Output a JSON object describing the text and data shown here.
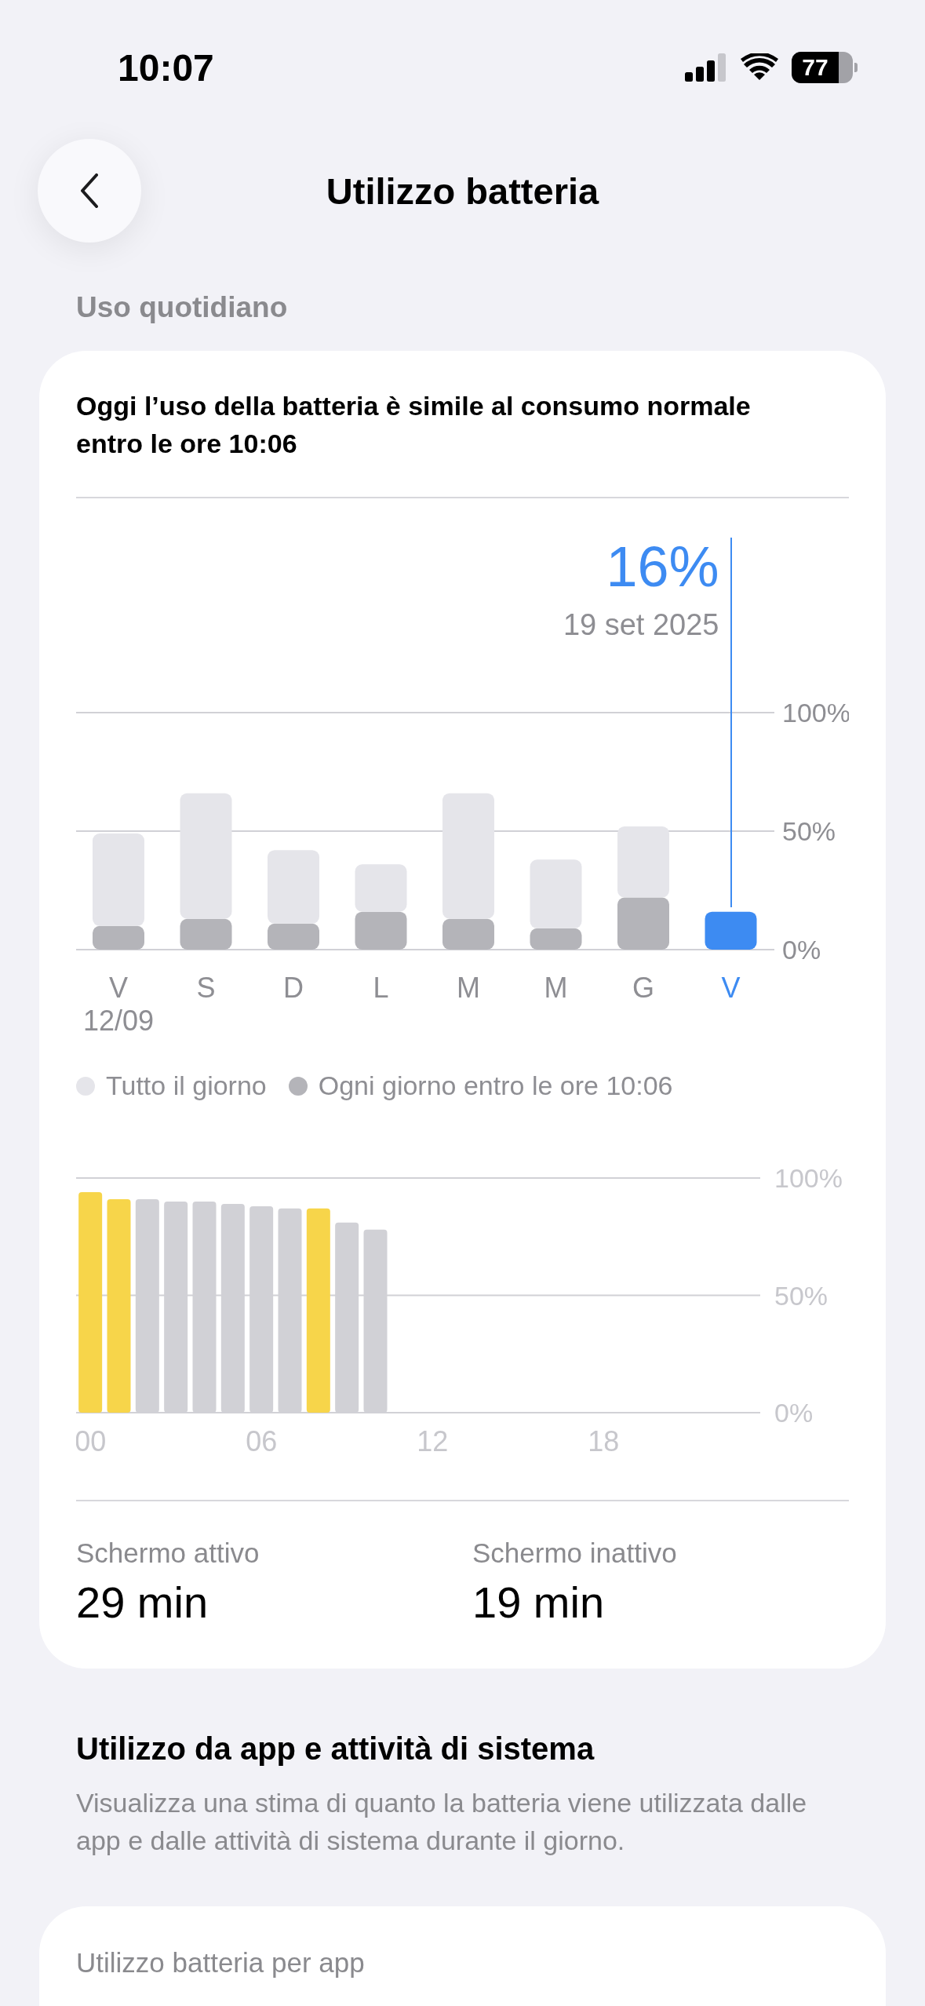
{
  "status_bar": {
    "time": "10:07",
    "battery": "77"
  },
  "nav": {
    "title": "Utilizzo batteria"
  },
  "daily": {
    "section_title": "Uso quotidiano",
    "headline": "Oggi l’uso della batteria è simile al consumo normale entro le ore 10:06",
    "chart_data": {
      "type": "bar",
      "stacked": true,
      "categories": [
        "V\n12/09",
        "S",
        "D",
        "L",
        "M",
        "M",
        "G",
        "V"
      ],
      "series": [
        {
          "name": "Ogni giorno entro le ore 10:06",
          "color": "#b4b4b9",
          "values": [
            10,
            13,
            11,
            16,
            13,
            9,
            22,
            null
          ]
        },
        {
          "name": "Tutto il giorno",
          "color": "#e5e5ea",
          "values": [
            39,
            53,
            31,
            20,
            53,
            29,
            30,
            null
          ]
        },
        {
          "color": "#3d8bf2",
          "values": [
            null,
            null,
            null,
            null,
            null,
            null,
            null,
            16
          ]
        }
      ],
      "ylim": [
        0,
        100
      ],
      "yticks": [
        {
          "value": 0,
          "label": "0%"
        },
        {
          "value": 50,
          "label": "50%"
        },
        {
          "value": 100,
          "label": "100%"
        }
      ],
      "annotations": [
        "16%",
        "19 set 2025"
      ]
    },
    "hourly": {
      "chart_data": {
        "type": "bar",
        "x": [
          0,
          1,
          2,
          3,
          4,
          5,
          6,
          7,
          8,
          9,
          10
        ],
        "xlim": [
          -0.5,
          23.5
        ],
        "ylim": [
          0,
          100
        ],
        "series": [
          {
            "color": "#f7d54a",
            "values": [
              94,
              91,
              null,
              null,
              null,
              null,
              null,
              null,
              87,
              null,
              null
            ]
          },
          {
            "color": "#d1d1d6",
            "values": [
              null,
              null,
              91,
              90,
              90,
              89,
              88,
              87,
              null,
              81,
              78
            ]
          }
        ],
        "xticks": [
          {
            "value": 0,
            "label": "00"
          },
          {
            "value": 6,
            "label": "06"
          },
          {
            "value": 12,
            "label": "12"
          },
          {
            "value": 18,
            "label": "18"
          }
        ],
        "yticks": [
          {
            "value": 0,
            "label": "0%"
          },
          {
            "value": 50,
            "label": "50%"
          },
          {
            "value": 100,
            "label": "100%"
          }
        ]
      }
    },
    "stats": [
      {
        "label": "Schermo attivo",
        "value": "29 min"
      },
      {
        "label": "Schermo inattivo",
        "value": "19 min"
      }
    ]
  },
  "apps": {
    "title": "Utilizzo da app e attività di sistema",
    "description": "Visualizza una stima di quanto la batteria viene utilizzata dalle app e dalle attività di sistema durante il giorno.",
    "card_title": "Utilizzo batteria per app"
  }
}
